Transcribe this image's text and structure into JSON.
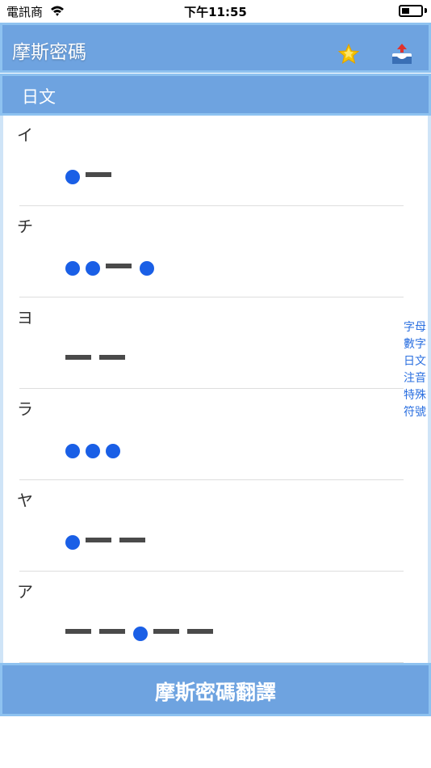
{
  "status": {
    "carrier": "電訊商",
    "time": "下午11:55"
  },
  "header": {
    "title": "摩斯密碼"
  },
  "section": {
    "title": "日文"
  },
  "items": [
    {
      "char": "イ",
      "code": ".-"
    },
    {
      "char": "チ",
      "code": "..-."
    },
    {
      "char": "ヨ",
      "code": "--"
    },
    {
      "char": "ラ",
      "code": "..."
    },
    {
      "char": "ヤ",
      "code": ".--"
    },
    {
      "char": "ア",
      "code": "--.--"
    }
  ],
  "index": [
    "字母",
    "數字",
    "日文",
    "注音",
    "特殊",
    "符號"
  ],
  "footer": {
    "label": "摩斯密碼翻譯"
  },
  "colors": {
    "header_bg": "#6ea3e0",
    "header_border": "#8ec2f0",
    "dot": "#1a5fe6",
    "dash": "#4a4a4a",
    "index": "#2a6fe0"
  }
}
